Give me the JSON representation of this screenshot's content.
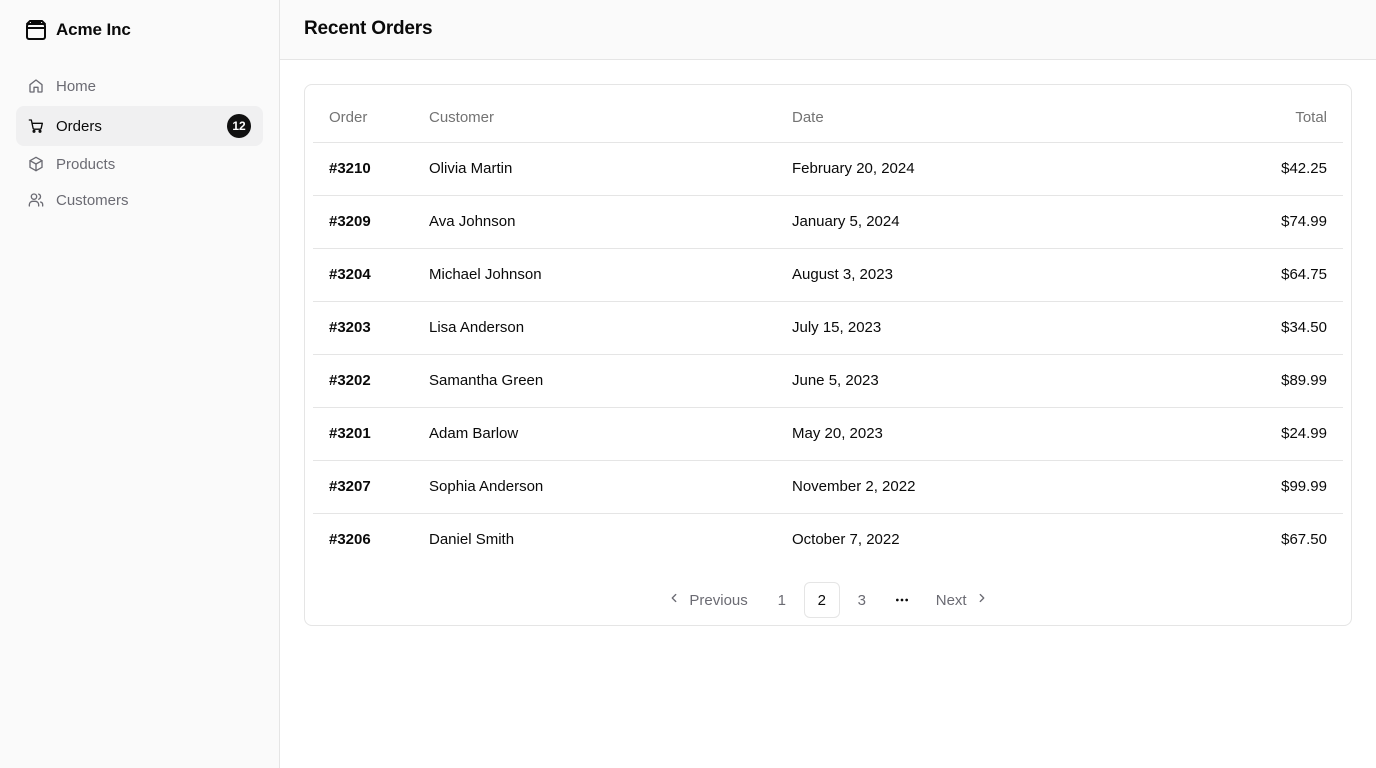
{
  "brand": {
    "name": "Acme Inc",
    "icon": "package-icon"
  },
  "sidebar": {
    "items": [
      {
        "label": "Home",
        "icon": "home-icon",
        "active": false
      },
      {
        "label": "Orders",
        "icon": "cart-icon",
        "active": true,
        "badge": "12"
      },
      {
        "label": "Products",
        "icon": "package-icon",
        "active": false
      },
      {
        "label": "Customers",
        "icon": "users-icon",
        "active": false
      }
    ]
  },
  "header": {
    "title": "Recent Orders"
  },
  "table": {
    "columns": [
      "Order",
      "Customer",
      "Date",
      "Total"
    ],
    "rows": [
      {
        "order": "#3210",
        "customer": "Olivia Martin",
        "date": "February 20, 2024",
        "total": "$42.25"
      },
      {
        "order": "#3209",
        "customer": "Ava Johnson",
        "date": "January 5, 2024",
        "total": "$74.99"
      },
      {
        "order": "#3204",
        "customer": "Michael Johnson",
        "date": "August 3, 2023",
        "total": "$64.75"
      },
      {
        "order": "#3203",
        "customer": "Lisa Anderson",
        "date": "July 15, 2023",
        "total": "$34.50"
      },
      {
        "order": "#3202",
        "customer": "Samantha Green",
        "date": "June 5, 2023",
        "total": "$89.99"
      },
      {
        "order": "#3201",
        "customer": "Adam Barlow",
        "date": "May 20, 2023",
        "total": "$24.99"
      },
      {
        "order": "#3207",
        "customer": "Sophia Anderson",
        "date": "November 2, 2022",
        "total": "$99.99"
      },
      {
        "order": "#3206",
        "customer": "Daniel Smith",
        "date": "October 7, 2022",
        "total": "$67.50"
      }
    ]
  },
  "pagination": {
    "previous_label": "Previous",
    "next_label": "Next",
    "pages": [
      "1",
      "2",
      "3"
    ],
    "current_page": "2",
    "ellipsis": "•••"
  },
  "colors": {
    "sidebar_bg": "#fafafa",
    "border": "#e5e5e5",
    "active_nav_bg": "#f0f0f1",
    "badge_bg": "#111111",
    "muted_text": "#737373"
  }
}
